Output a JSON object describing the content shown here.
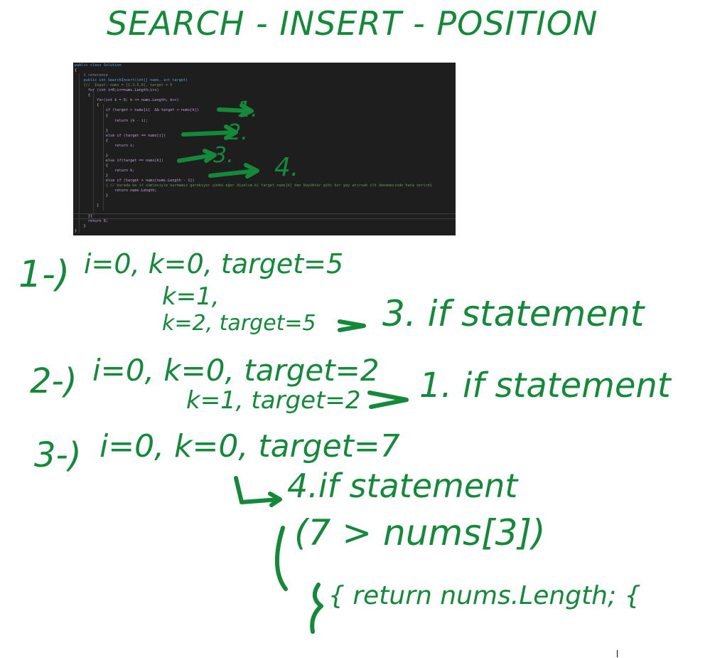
{
  "title": "SEARCH - INSERT - POSITION",
  "code": {
    "lines": [
      "public class Solution",
      "{",
      "    1 reference",
      "    public int SearchInsert(int[] nums, int target)",
      "    {//  Input: nums = [1,3,5,6], target = 5",
      "      for (int i=0;i<=nums.Length;i++)",
      "      {",
      "          for(int k = 0; k <= nums.Length; k++)",
      "          {",
      "              if (target > nums[i]  && target < nums[k])",
      "              {",
      "                  return (k - i);",
      "",
      "              }",
      "              else if (target == nums[i])",
      "              {",
      "                  return i;",
      "",
      "              }",
      "              else if(target == nums[k])",
      "              {",
      "                  return k;",
      "              }",
      "              else if (target > nums[nums.Length - 1])",
      "              { // burada bu if cümlesiyle kurmamız gerekiyor çünkü eğer diyelim ki target nums[k] dan büyüktür gibi bir şey atırsak ilk denemesinde hata verirdi",
      "                  return nums.Length;",
      "              }",
      "",
      "          }",
      "",
      "      }{",
      "      return 0;",
      "    }",
      "}"
    ]
  },
  "arrow_labels": [
    "1.",
    "2.",
    "3.",
    "4."
  ],
  "notes": {
    "n1_label": "1-)",
    "n1_line1": "i=0, k=0, target=5",
    "n1_line2": "k=1,",
    "n1_line3": "k=2, target=5",
    "n1_result": "3. if statement",
    "n2_label": "2-)",
    "n2_line1": "i=0, k=0, target=2",
    "n2_line2": "k=1, target=2",
    "n2_result": "1. if statement",
    "n3_label": "3-)",
    "n3_line1": "i=0, k=0, target=7",
    "n3_result": "4.if statement",
    "n3_check": "(7 > nums[3])",
    "n3_return": "{ return   nums.Length; {"
  },
  "colors": {
    "ink": "#128a3a",
    "editor_bg": "#1e1e1e"
  }
}
